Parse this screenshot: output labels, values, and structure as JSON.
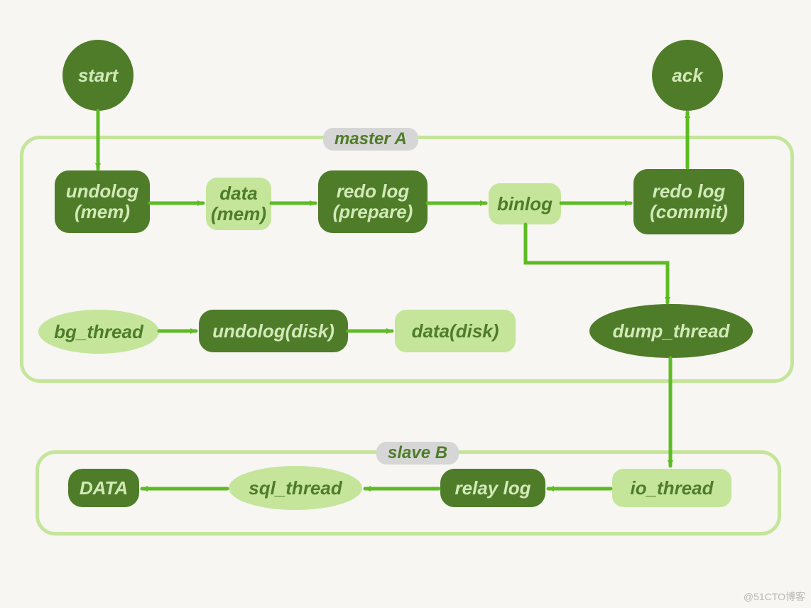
{
  "regions": {
    "master": {
      "label": "master A"
    },
    "slave": {
      "label": "slave B"
    }
  },
  "nodes": {
    "start": {
      "label": "start"
    },
    "ack": {
      "label": "ack"
    },
    "undolog_mem": {
      "label": "undolog\n(mem)"
    },
    "data_mem": {
      "label": "data\n(mem)"
    },
    "redo_prepare": {
      "label": "redo log\n(prepare)"
    },
    "binlog": {
      "label": "binlog"
    },
    "redo_commit": {
      "label": "redo log\n(commit)"
    },
    "bg_thread": {
      "label": "bg_thread"
    },
    "undolog_disk": {
      "label": "undolog(disk)"
    },
    "data_disk": {
      "label": "data(disk)"
    },
    "dump_thread": {
      "label": "dump_thread"
    },
    "io_thread": {
      "label": "io_thread"
    },
    "relay_log": {
      "label": "relay log"
    },
    "sql_thread": {
      "label": "sql_thread"
    },
    "data_final": {
      "label": "DATA"
    }
  },
  "watermark": "@51CTO博客"
}
